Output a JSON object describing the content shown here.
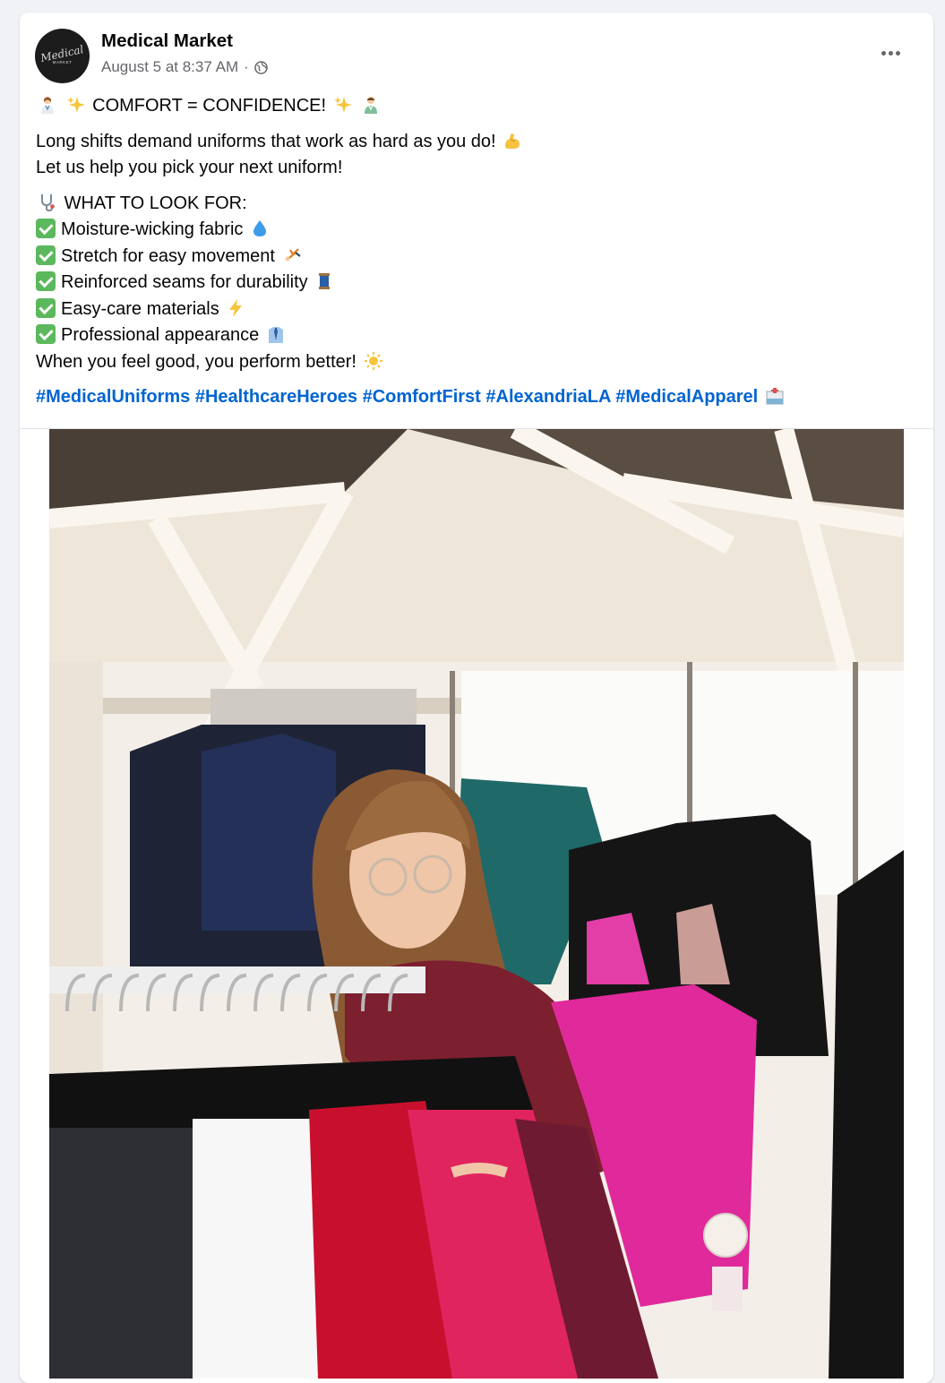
{
  "post": {
    "author": "Medical Market",
    "avatar_text_script": "Medical",
    "avatar_text_small": "MARKET",
    "timestamp": "August 5 at 8:37 AM",
    "separator": "·",
    "audience_icon": "globe-icon",
    "more_icon": "more-options-icon",
    "headline": "COMFORT = CONFIDENCE!",
    "intro_line_1": "Long shifts demand uniforms that work as hard as you do!",
    "intro_line_2": "Let us help you pick your next uniform!",
    "checklist_heading": "WHAT TO LOOK FOR:",
    "checklist": [
      "Moisture-wicking fabric",
      "Stretch for easy movement",
      "Reinforced seams for durability",
      "Easy-care materials",
      "Professional appearance"
    ],
    "closing_line": "When you feel good, you perform better!",
    "hashtags": [
      "#MedicalUniforms",
      "#HealthcareHeroes",
      "#ComfortFirst",
      "#AlexandriaLA",
      "#MedicalApparel"
    ],
    "photo_description_icon": "photo-woman-browsing-scrubs"
  },
  "colors": {
    "hashtag": "#0064d1",
    "secondary_text": "#65676b",
    "check_box": "#5cb85c"
  }
}
